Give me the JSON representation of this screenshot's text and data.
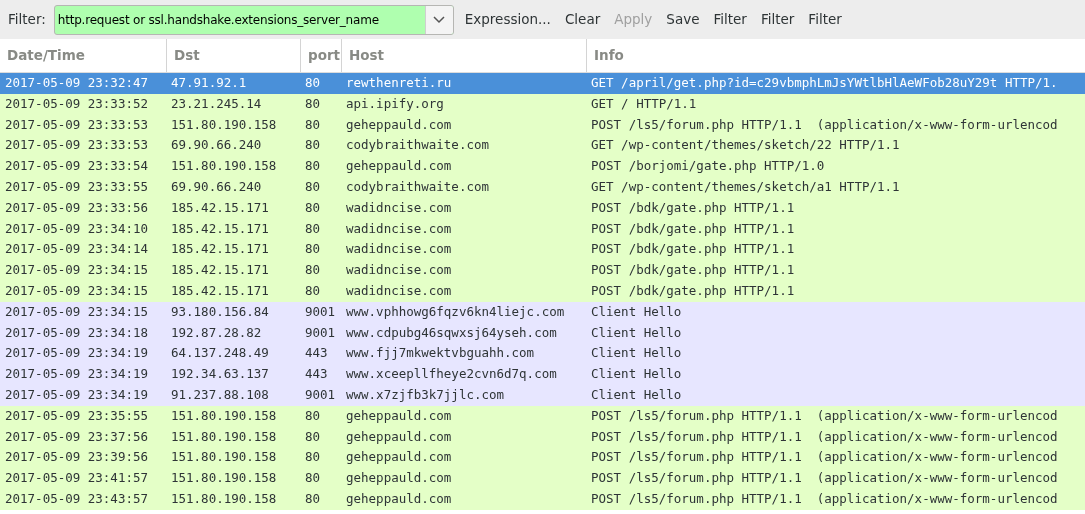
{
  "toolbar": {
    "label": "Filter:",
    "filter": {
      "value": "http.request or ssl.handshake.extensions_server_name",
      "valid": true
    },
    "buttons": [
      {
        "label": "Expression...",
        "disabled": false
      },
      {
        "label": "Clear",
        "disabled": false
      },
      {
        "label": "Apply",
        "disabled": true
      },
      {
        "label": "Save",
        "disabled": false
      },
      {
        "label": "Filter",
        "disabled": false
      },
      {
        "label": "Filter",
        "disabled": false
      },
      {
        "label": "Filter",
        "disabled": false
      }
    ]
  },
  "table": {
    "columns": [
      "Date/Time",
      "Dst",
      "port",
      "Host",
      "Info"
    ],
    "rows": [
      {
        "cells": [
          "2017-05-09 23:32:47",
          "47.91.92.1",
          "80",
          "rewthenreti.ru",
          "GET /april/get.php?id=c29vbmphLmJsYWtlbHlAeWFob28uY29t HTTP/1."
        ],
        "selected": true
      },
      {
        "cells": [
          "2017-05-09 23:33:52",
          "23.21.245.14",
          "80",
          "api.ipify.org",
          "GET / HTTP/1.1"
        ],
        "color": "#e4ffc7",
        "selected": false
      },
      {
        "cells": [
          "2017-05-09 23:33:53",
          "151.80.190.158",
          "80",
          "geheppauld.com",
          "POST /ls5/forum.php HTTP/1.1  (application/x-www-form-urlencod"
        ],
        "color": "#e4ffc7",
        "selected": false
      },
      {
        "cells": [
          "2017-05-09 23:33:53",
          "69.90.66.240",
          "80",
          "codybraithwaite.com",
          "GET /wp-content/themes/sketch/22 HTTP/1.1"
        ],
        "color": "#e4ffc7",
        "selected": false
      },
      {
        "cells": [
          "2017-05-09 23:33:54",
          "151.80.190.158",
          "80",
          "geheppauld.com",
          "POST /borjomi/gate.php HTTP/1.0"
        ],
        "color": "#e4ffc7",
        "selected": false
      },
      {
        "cells": [
          "2017-05-09 23:33:55",
          "69.90.66.240",
          "80",
          "codybraithwaite.com",
          "GET /wp-content/themes/sketch/a1 HTTP/1.1"
        ],
        "color": "#e4ffc7",
        "selected": false
      },
      {
        "cells": [
          "2017-05-09 23:33:56",
          "185.42.15.171",
          "80",
          "wadidncise.com",
          "POST /bdk/gate.php HTTP/1.1"
        ],
        "color": "#e4ffc7",
        "selected": false
      },
      {
        "cells": [
          "2017-05-09 23:34:10",
          "185.42.15.171",
          "80",
          "wadidncise.com",
          "POST /bdk/gate.php HTTP/1.1"
        ],
        "color": "#e4ffc7",
        "selected": false
      },
      {
        "cells": [
          "2017-05-09 23:34:14",
          "185.42.15.171",
          "80",
          "wadidncise.com",
          "POST /bdk/gate.php HTTP/1.1"
        ],
        "color": "#e4ffc7",
        "selected": false
      },
      {
        "cells": [
          "2017-05-09 23:34:15",
          "185.42.15.171",
          "80",
          "wadidncise.com",
          "POST /bdk/gate.php HTTP/1.1"
        ],
        "color": "#e4ffc7",
        "selected": false
      },
      {
        "cells": [
          "2017-05-09 23:34:15",
          "185.42.15.171",
          "80",
          "wadidncise.com",
          "POST /bdk/gate.php HTTP/1.1"
        ],
        "color": "#e4ffc7",
        "selected": false
      },
      {
        "cells": [
          "2017-05-09 23:34:15",
          "93.180.156.84",
          "9001",
          "www.vphhowg6fqzv6kn4liejc.com",
          "Client Hello"
        ],
        "color": "#e7e6ff",
        "selected": false
      },
      {
        "cells": [
          "2017-05-09 23:34:18",
          "192.87.28.82",
          "9001",
          "www.cdpubg46sqwxsj64yseh.com",
          "Client Hello"
        ],
        "color": "#e7e6ff",
        "selected": false
      },
      {
        "cells": [
          "2017-05-09 23:34:19",
          "64.137.248.49",
          "443",
          "www.fjj7mkwektvbguahh.com",
          "Client Hello"
        ],
        "color": "#e7e6ff",
        "selected": false
      },
      {
        "cells": [
          "2017-05-09 23:34:19",
          "192.34.63.137",
          "443",
          "www.xceepllfheye2cvn6d7q.com",
          "Client Hello"
        ],
        "color": "#e7e6ff",
        "selected": false
      },
      {
        "cells": [
          "2017-05-09 23:34:19",
          "91.237.88.108",
          "9001",
          "www.x7zjfb3k7jjlc.com",
          "Client Hello"
        ],
        "color": "#e7e6ff",
        "selected": false
      },
      {
        "cells": [
          "2017-05-09 23:35:55",
          "151.80.190.158",
          "80",
          "geheppauld.com",
          "POST /ls5/forum.php HTTP/1.1  (application/x-www-form-urlencod"
        ],
        "color": "#e4ffc7",
        "selected": false
      },
      {
        "cells": [
          "2017-05-09 23:37:56",
          "151.80.190.158",
          "80",
          "geheppauld.com",
          "POST /ls5/forum.php HTTP/1.1  (application/x-www-form-urlencod"
        ],
        "color": "#e4ffc7",
        "selected": false
      },
      {
        "cells": [
          "2017-05-09 23:39:56",
          "151.80.190.158",
          "80",
          "geheppauld.com",
          "POST /ls5/forum.php HTTP/1.1  (application/x-www-form-urlencod"
        ],
        "color": "#e4ffc7",
        "selected": false
      },
      {
        "cells": [
          "2017-05-09 23:41:57",
          "151.80.190.158",
          "80",
          "geheppauld.com",
          "POST /ls5/forum.php HTTP/1.1  (application/x-www-form-urlencod"
        ],
        "color": "#e4ffc7",
        "selected": false
      },
      {
        "cells": [
          "2017-05-09 23:43:57",
          "151.80.190.158",
          "80",
          "geheppauld.com",
          "POST /ls5/forum.php HTTP/1.1  (application/x-www-form-urlencod"
        ],
        "color": "#e4ffc7",
        "selected": false
      }
    ]
  }
}
